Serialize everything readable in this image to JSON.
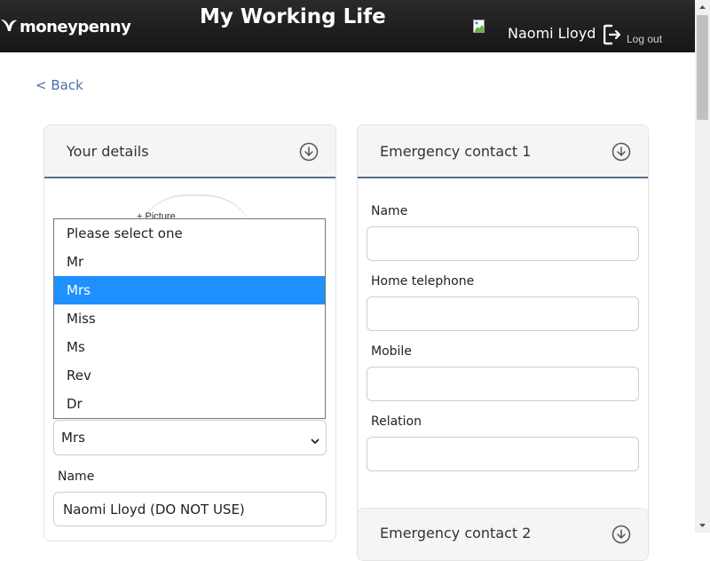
{
  "app": {
    "logo_text": "moneypenny",
    "title": "My Working Life"
  },
  "user": {
    "name": "Naomi Lloyd",
    "logout_label": "Log out"
  },
  "nav": {
    "back_label": "< Back"
  },
  "your_details": {
    "title": "Your details",
    "picture_label": "+ Picture",
    "title_select": {
      "selected": "Mrs",
      "options": [
        "Please select one",
        "Mr",
        "Mrs",
        "Miss",
        "Ms",
        "Rev",
        "Dr"
      ],
      "highlighted_index": 2
    },
    "name_label": "Name",
    "name_value": "Naomi Lloyd (DO NOT USE)"
  },
  "emergency_contact_1": {
    "title": "Emergency contact 1",
    "fields": [
      {
        "label": "Name",
        "value": ""
      },
      {
        "label": "Home telephone",
        "value": ""
      },
      {
        "label": "Mobile",
        "value": ""
      },
      {
        "label": "Relation",
        "value": ""
      }
    ]
  },
  "emergency_contact_2": {
    "title": "Emergency contact 2"
  },
  "colors": {
    "topbar": "#1e1e1e",
    "accent_line": "#5a6e8a",
    "selected_option": "#1e90ff",
    "back_link": "#4a6fa5"
  },
  "icons": {
    "logo": "bird-icon",
    "avatar": "broken-image-icon",
    "logout": "logout-icon",
    "panel_toggle": "circle-arrow-down-icon",
    "select": "chevron-down-icon"
  }
}
